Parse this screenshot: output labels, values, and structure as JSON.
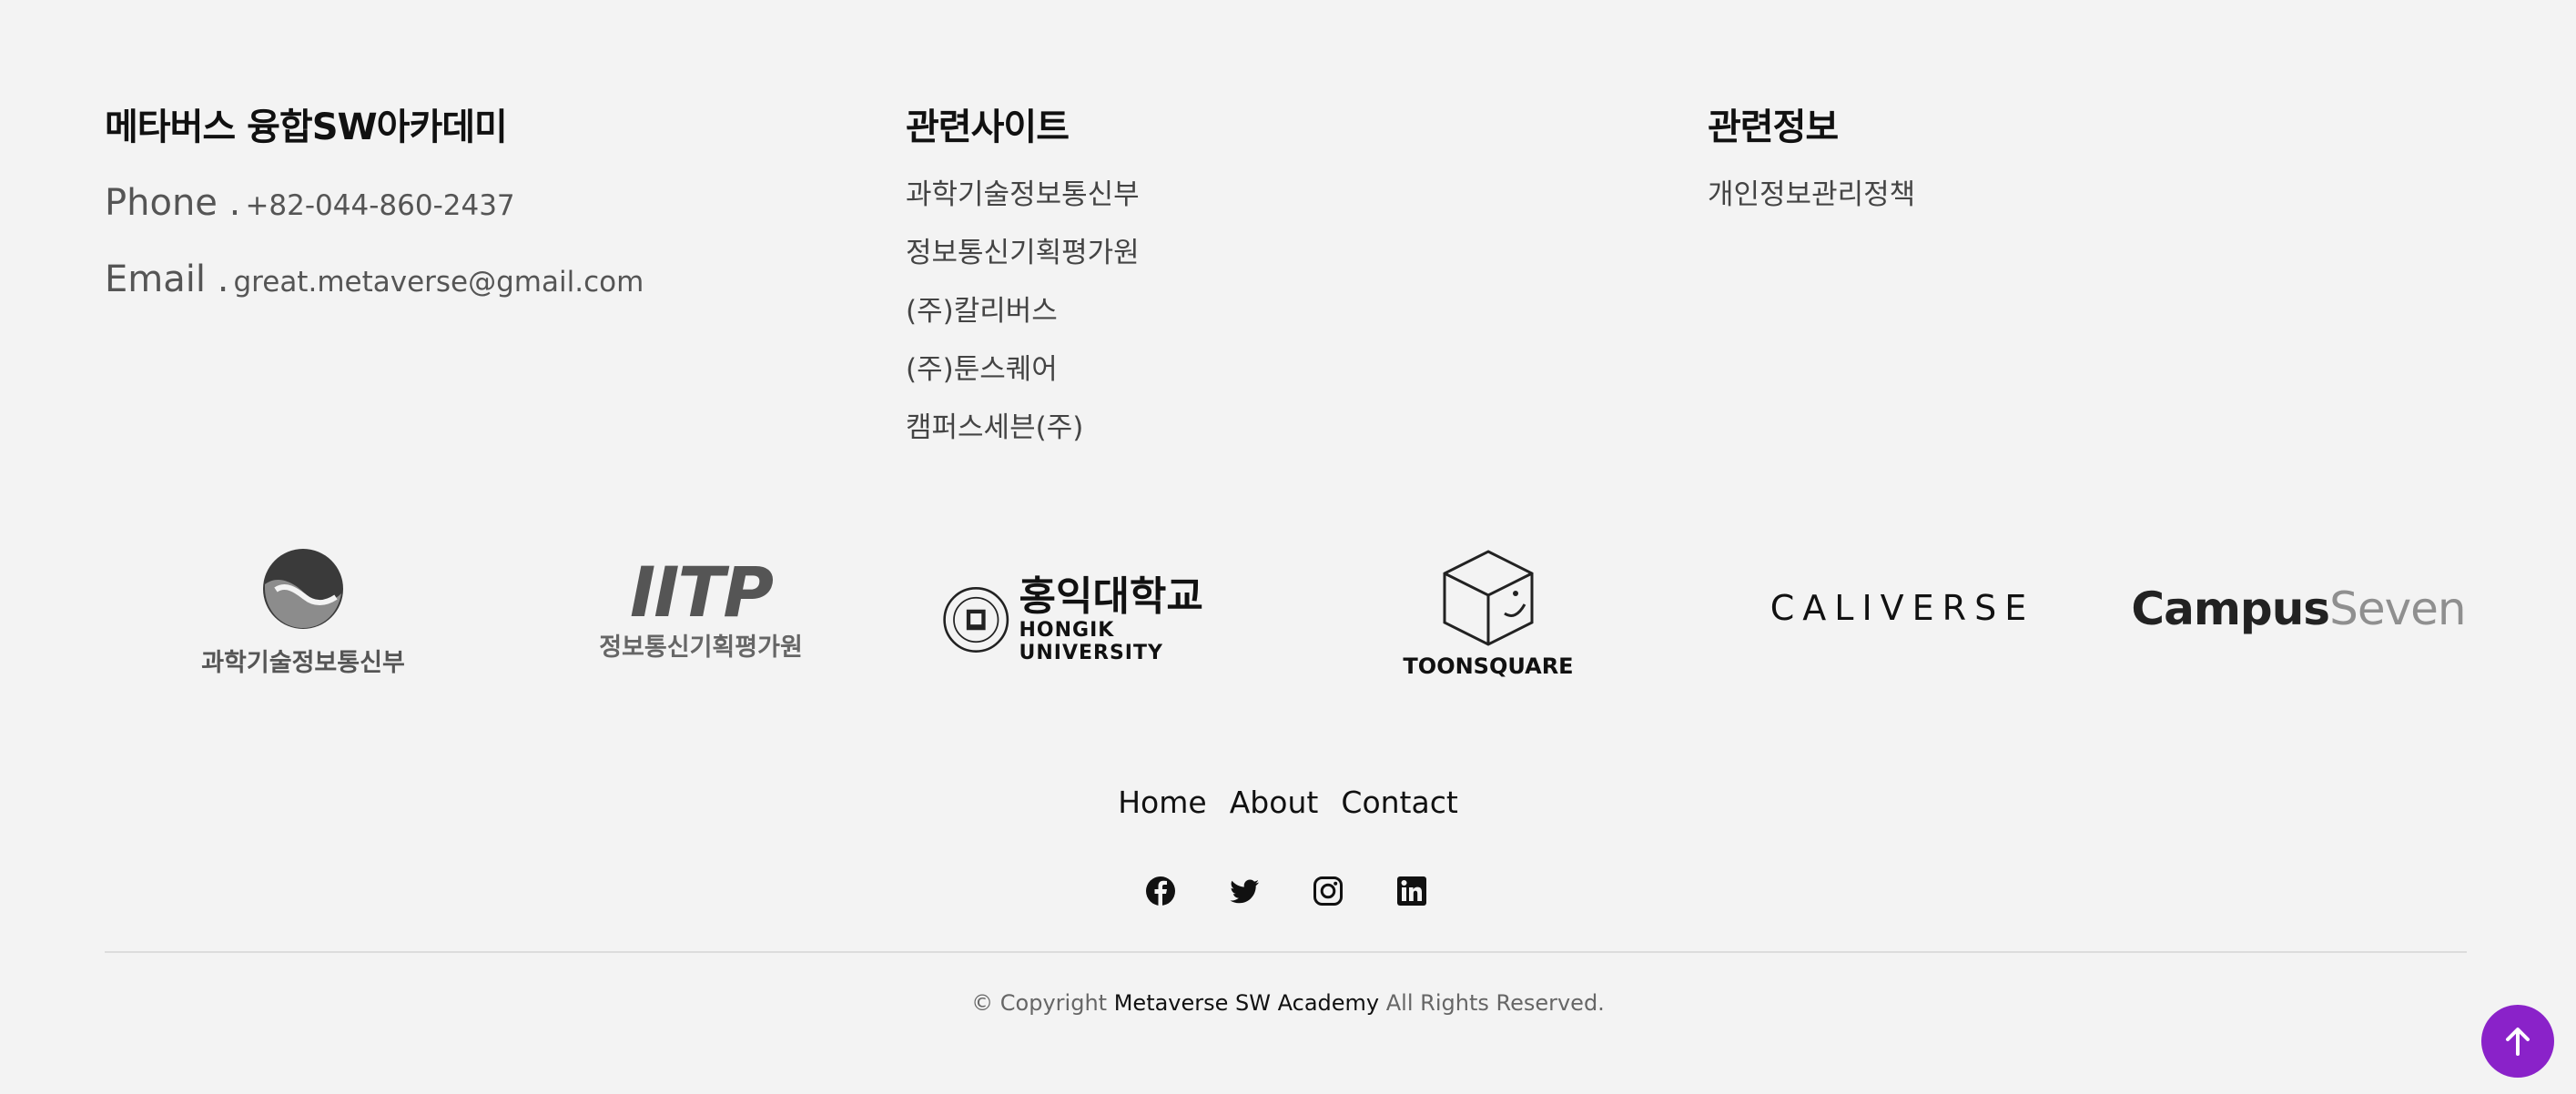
{
  "academy": {
    "title": "메타버스 융합SW아카데미",
    "phone_label": "Phone .",
    "phone": "+82-044-860-2437",
    "email_label": "Email .",
    "email": "great.metaverse@gmail.com"
  },
  "related_sites": {
    "title": "관련사이트",
    "items": [
      {
        "label": "과학기술정보통신부"
      },
      {
        "label": "정보통신기획평가원"
      },
      {
        "label": "(주)칼리버스"
      },
      {
        "label": "(주)툰스퀘어"
      },
      {
        "label": "캠퍼스세븐(주)"
      }
    ]
  },
  "related_info": {
    "title": "관련정보",
    "items": [
      {
        "label": "개인정보관리정책"
      }
    ]
  },
  "logos": {
    "msit": "과학기술정보통신부",
    "iitp_text": "IITP",
    "iitp": "정보통신기획평가원",
    "hongik_kr": "홍익대학교",
    "hongik_en": "HONGIK UNIVERSITY",
    "toonsquare": "TOONSQUARE",
    "caliverse": "CALIVERSE",
    "campus_a": "Campus",
    "campus_b": "Seven"
  },
  "nav": {
    "home": "Home",
    "about": "About",
    "contact": "Contact"
  },
  "social": [
    "facebook-icon",
    "twitter-icon",
    "instagram-icon",
    "linkedin-icon"
  ],
  "copyright": {
    "prefix": "© Copyright",
    "brand": "Metaverse SW Academy",
    "suffix": "All Rights Reserved."
  },
  "colors": {
    "background": "#f3f3f3",
    "accent": "#8a22c9"
  }
}
